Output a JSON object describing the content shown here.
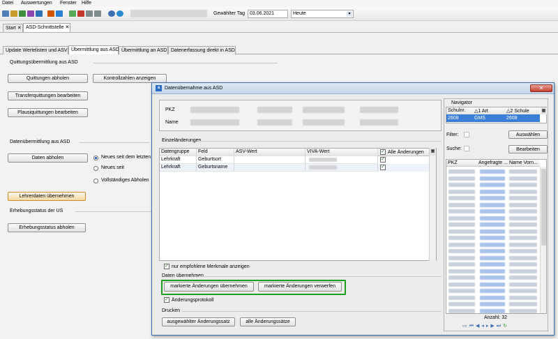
{
  "menu": {
    "items": [
      "Datei",
      "Auswertungen",
      "Fenster",
      "Hilfe"
    ]
  },
  "toolbar": {
    "day_label": "Gewählter Tag",
    "day_value": "03.06.2021",
    "period_value": "Heute"
  },
  "doc_tabs": {
    "start": "Start",
    "asd": "ASD-Schnittstelle",
    "close": "✕"
  },
  "sub_tabs": [
    "Update Wertelisten und ASV",
    "Übermittlung aus ASD",
    "Übermittlung an ASD",
    "Datenerfassung direkt in ASD"
  ],
  "left": {
    "quittung_title": "Quittungsübermittlung aus ASD",
    "btn_quittungen": "Quittungen abholen",
    "btn_kontrollzahlen": "Kontrollzahlen anzeigen",
    "btn_transfer": "Transferquittungen bearbeiten",
    "btn_plausi": "Plausiquittungen bearbeiten",
    "daten_title": "Datenübermittlung aus ASD",
    "btn_daten": "Daten abholen",
    "radio_neu_letzten": "Neues seit dem letzten",
    "radio_neu_seit": "Neues seit",
    "radio_vollstaendig": "Vollständiges Abholen",
    "btn_lehrer": "Lehrerdaten übernehmen",
    "erhebung_title": "Erhebungsstatus der US",
    "btn_erhebung": "Erhebungsstatus abholen"
  },
  "dialog": {
    "title": "Datenübernahme aus ASD",
    "pkz_label": "PKZ",
    "name_label": "Name",
    "einzel_title": "Einzeländerungen",
    "columns": [
      "Datengruppe",
      "Feld",
      "ASV-Wert",
      "VIVA-Wert"
    ],
    "all_changes_label": "Alle Änderungen",
    "rows": [
      {
        "gruppe": "Lehrkraft",
        "feld": "Geburtsort"
      },
      {
        "gruppe": "Lehrkraft",
        "feld": "Geburtsname"
      }
    ],
    "empfohlen_label": "nur empfohlene Merkmale anzeigen",
    "uebernehmen_title": "Daten übernehmen",
    "btn_uebernehmen": "markierte Änderungen übernehmen",
    "btn_verwerfen": "markierte Änderungen verwerfen",
    "protokoll_label": "Änderungsprotokoll",
    "drucken_title": "Drucken",
    "btn_ausgewaehlt": "ausgewählter Änderungssatz",
    "btn_alle": "alle Änderungssätze",
    "highlight_color": "#1e9e1e"
  },
  "navigator": {
    "title": "Navigator",
    "col_schulnr": "Schulnr.",
    "col_art": "△1 Art",
    "col_schule": "△2 Schule",
    "row": {
      "schulnr": "2608",
      "art": "GMS",
      "schule": "2608"
    },
    "filter_label": "Filter:",
    "suche_label": "Suche:",
    "btn_auswaehlen": "Auswählen",
    "btn_bearbeiten": "Bearbeiten",
    "col_pkz": "PKZ",
    "col_angefragt": "Angefragte ...",
    "col_name": "Name Vorn...",
    "count_label": "Anzahl: 32"
  },
  "colors": {
    "selection": "#3a7fd5",
    "accent": "#1e9e1e"
  }
}
